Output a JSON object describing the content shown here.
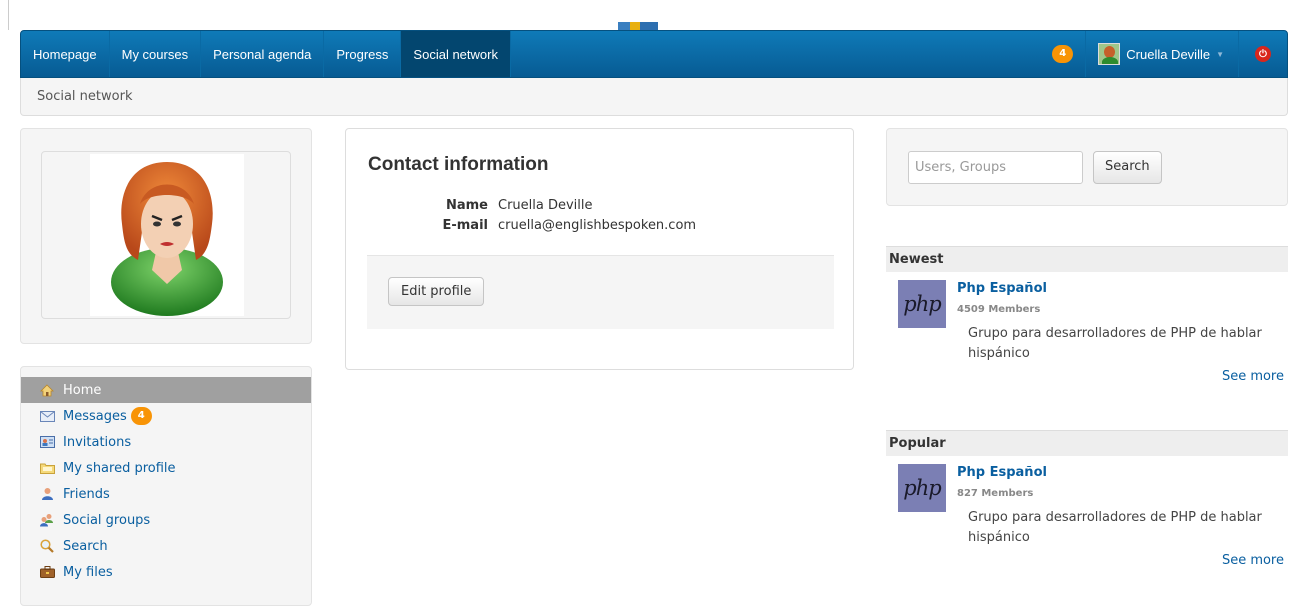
{
  "navbar": {
    "items": [
      {
        "label": "Homepage"
      },
      {
        "label": "My courses"
      },
      {
        "label": "Personal agenda"
      },
      {
        "label": "Progress"
      },
      {
        "label": "Social network"
      }
    ],
    "notifications_count": "4",
    "user_name": "Cruella Deville",
    "logout_icon": "power-icon"
  },
  "breadcrumb": "Social network",
  "contact": {
    "title": "Contact information",
    "name_label": "Name",
    "name_value": "Cruella Deville",
    "email_label": "E-mail",
    "email_value": "cruella@englishbespoken.com",
    "edit_button": "Edit profile"
  },
  "search": {
    "placeholder": "Users, Groups",
    "button": "Search"
  },
  "menu": {
    "items": [
      {
        "label": "Home",
        "icon": "home-icon"
      },
      {
        "label": "Messages",
        "icon": "envelope-icon",
        "badge": "4"
      },
      {
        "label": "Invitations",
        "icon": "invitation-icon"
      },
      {
        "label": "My shared profile",
        "icon": "folder-icon"
      },
      {
        "label": "Friends",
        "icon": "user-icon"
      },
      {
        "label": "Social groups",
        "icon": "group-icon"
      },
      {
        "label": "Search",
        "icon": "magnifier-icon"
      },
      {
        "label": "My files",
        "icon": "briefcase-icon"
      }
    ]
  },
  "newest": {
    "header": "Newest",
    "group_name": "Php Español",
    "members": "4509 Members",
    "description": "Grupo para desarrolladores de PHP de hablar hispánico",
    "see_more": "See more",
    "logo_text": "php"
  },
  "popular": {
    "header": "Popular",
    "group_name": "Php Español",
    "members": "827 Members",
    "description": "Grupo para desarrolladores de PHP de hablar hispánico",
    "see_more": "See more",
    "logo_text": "php"
  },
  "colors": {
    "navbar": "#0f7ab8",
    "navbar_active": "#03466f",
    "badge": "#f89406",
    "link": "#0a5fa0"
  }
}
